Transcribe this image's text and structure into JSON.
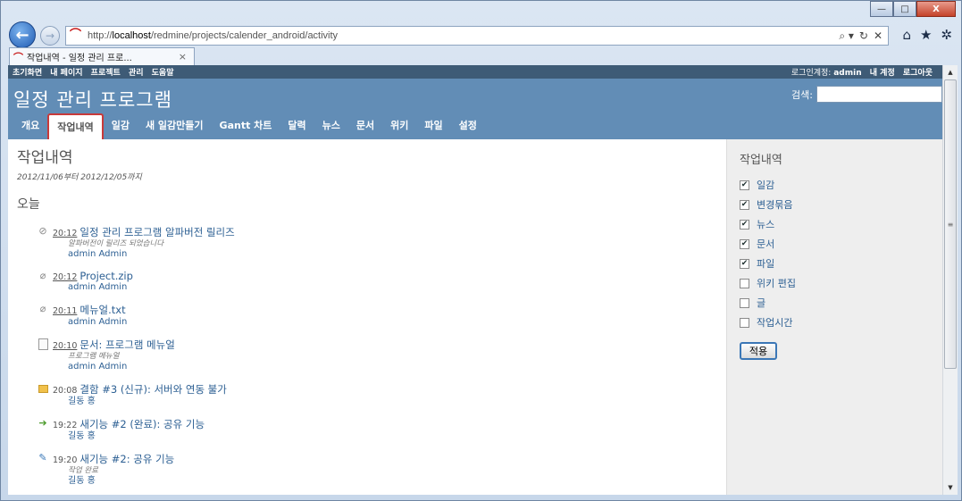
{
  "browser": {
    "url": "http://localhost/redmine/projects/calender_android/activity",
    "url_host_part": "localhost",
    "url_prefix": "http://",
    "url_suffix": "/redmine/projects/calender_android/activity",
    "tab_title": "작업내역 - 일정 관리 프로...",
    "tab_close": "×",
    "win_minimize": "—",
    "win_restore": "□",
    "win_close": "X",
    "search_ctrl": "⌕ ▾",
    "refresh_ctrl": "↻",
    "stop_ctrl": "✕",
    "home_icon": "⌂",
    "fav_icon": "★",
    "tools_icon": "✲"
  },
  "top_menu": {
    "items": [
      "초기화면",
      "내 페이지",
      "프로젝트",
      "관리",
      "도움말"
    ],
    "logged_in_label": "로그인계정:",
    "logged_in_user": "admin",
    "account_link": "내 계정",
    "logout_link": "로그아웃"
  },
  "header": {
    "project_title": "일정 관리 프로그램",
    "search_label": "검색:",
    "search_value": ""
  },
  "main_menu": {
    "items": [
      "개요",
      "작업내역",
      "일감",
      "새 일감만들기",
      "Gantt 차트",
      "달력",
      "뉴스",
      "문서",
      "위키",
      "파일",
      "설정"
    ],
    "selected": "작업내역"
  },
  "content": {
    "title": "작업내역",
    "date_range": "2012/11/06부터 2012/12/05까지",
    "day_heading": "오늘",
    "events": [
      {
        "time": "20:12",
        "title": "일정 관리 프로그램 알파버전 릴리즈",
        "desc": "알파버전이 릴리즈 되었습니다",
        "author": "admin Admin",
        "icon": "attachment-icon"
      },
      {
        "time": "20:12",
        "title": "Project.zip",
        "desc": "",
        "author": "admin Admin",
        "icon": "paperclip-icon"
      },
      {
        "time": "20:11",
        "title": "메뉴얼.txt",
        "desc": "",
        "author": "admin Admin",
        "icon": "paperclip-icon"
      },
      {
        "time": "20:10",
        "title": "문서: 프로그램 메뉴얼",
        "desc": "프로그램 메뉴얼",
        "author": "admin Admin",
        "icon": "document-icon"
      },
      {
        "time": "20:08",
        "title": "결함 #3 (신규): 서버와 연동 불가",
        "desc": "",
        "author": "길동 홍",
        "icon": "issue-new-icon"
      },
      {
        "time": "19:22",
        "title": "새기능 #2 (완료): 공유 기능",
        "desc": "",
        "author": "길동 홍",
        "icon": "issue-closed-icon"
      },
      {
        "time": "19:20",
        "title": "새기능 #2: 공유 기능",
        "desc": "작업 완료",
        "author": "길동 홍",
        "icon": "issue-edit-icon"
      }
    ]
  },
  "sidebar": {
    "title": "작업내역",
    "filters": [
      {
        "label": "일감",
        "checked": true
      },
      {
        "label": "변경묶음",
        "checked": true
      },
      {
        "label": "뉴스",
        "checked": true
      },
      {
        "label": "문서",
        "checked": true
      },
      {
        "label": "파일",
        "checked": true
      },
      {
        "label": "위키 편집",
        "checked": false
      },
      {
        "label": "글",
        "checked": false
      },
      {
        "label": "작업시간",
        "checked": false
      }
    ],
    "apply_button": "적용"
  },
  "colors": {
    "header_bg": "#628db6",
    "top_menu_bg": "#3e5b76",
    "link": "#2c5f93",
    "selected_outline": "#c83a3a"
  }
}
